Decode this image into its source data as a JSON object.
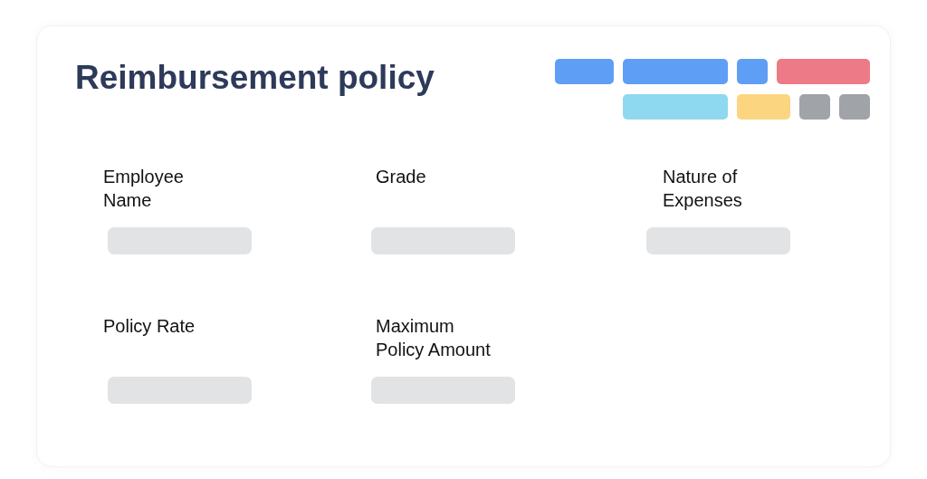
{
  "title": "Reimbursement policy",
  "tag_rows": [
    [
      {
        "color": "#5f9ef5"
      },
      {
        "color": "#5f9ef5"
      },
      {
        "color": "#5f9ef5"
      },
      {
        "color": "#ec7b87"
      }
    ],
    [
      {
        "color": "#8fd9f0"
      },
      {
        "color": "#fcd581"
      },
      {
        "color": "#a0a3a8"
      },
      {
        "color": "#a0a3a8"
      }
    ]
  ],
  "fields": [
    {
      "label": "Employee Name"
    },
    {
      "label": "Grade"
    },
    {
      "label": "Nature of Expenses"
    },
    {
      "label": "Policy Rate"
    },
    {
      "label": "Maximum Policy Amount"
    }
  ]
}
